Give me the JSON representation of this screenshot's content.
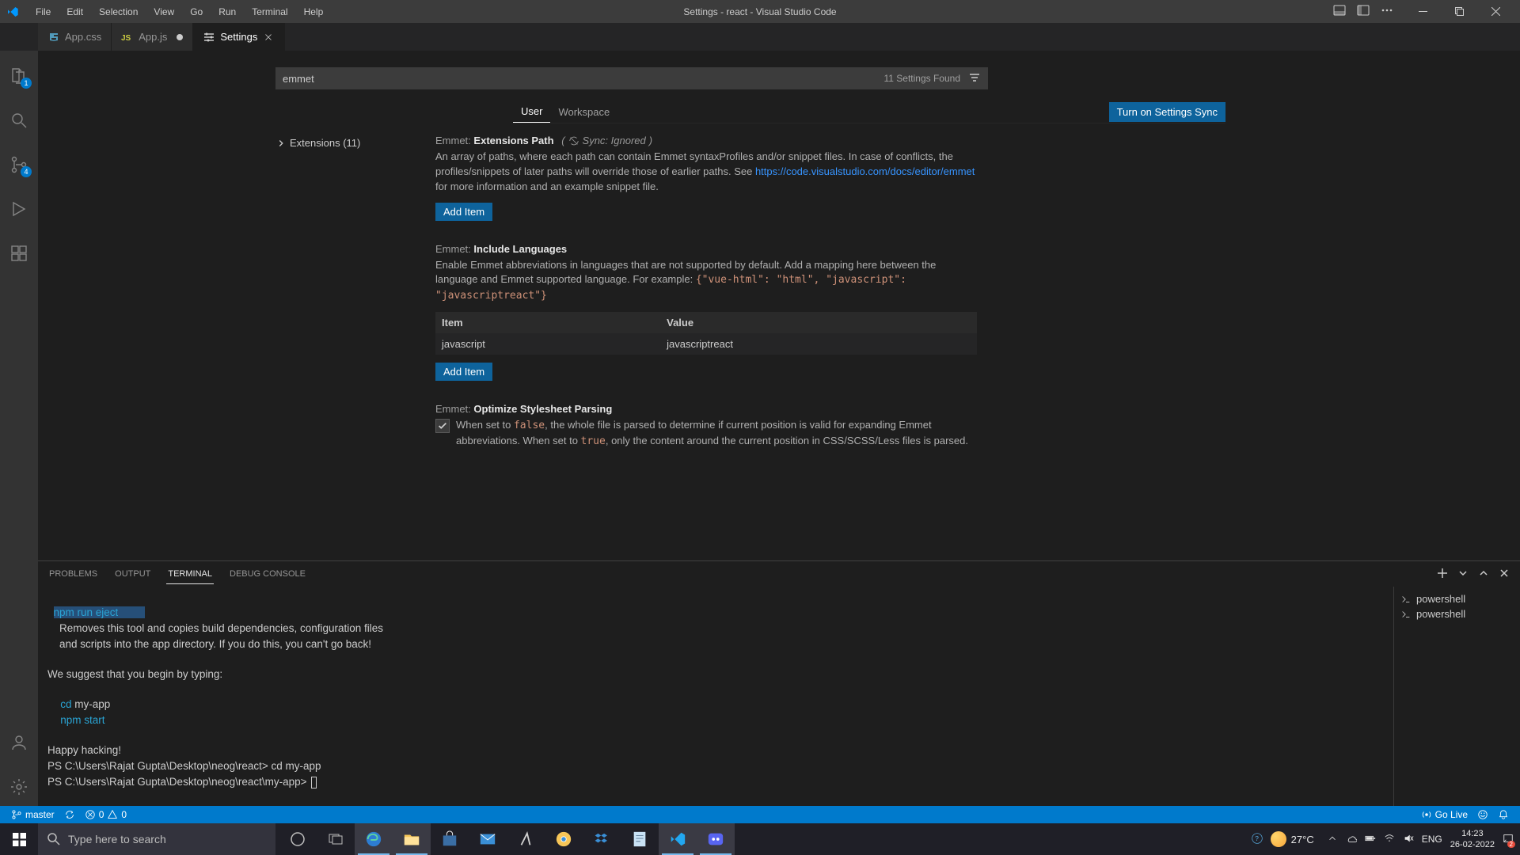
{
  "window": {
    "title": "Settings - react - Visual Studio Code"
  },
  "menu": [
    "File",
    "Edit",
    "Selection",
    "View",
    "Go",
    "Run",
    "Terminal",
    "Help"
  ],
  "tabs": [
    {
      "label": "App.css",
      "kind": "css",
      "active": false,
      "dirty": false
    },
    {
      "label": "App.js",
      "kind": "js",
      "active": false,
      "dirty": true
    },
    {
      "label": "Settings",
      "kind": "settings",
      "active": true,
      "dirty": false
    }
  ],
  "activity": {
    "explorer_badge": "1",
    "scm_badge": "4"
  },
  "settings": {
    "search_value": "emmet",
    "results_label": "11 Settings Found",
    "scope_tabs": [
      "User",
      "Workspace"
    ],
    "sync_button": "Turn on Settings Sync",
    "toc": {
      "extensions_label": "Extensions (11)"
    },
    "ext_path": {
      "prefix": "Emmet:",
      "name": "Extensions Path",
      "meta": "Sync: Ignored",
      "desc1": "An array of paths, where each path can contain Emmet syntaxProfiles and/or snippet files. In case of conflicts, the profiles/snippets of later paths will override those of earlier paths. See ",
      "link": "https://code.visualstudio.com/docs/editor/emmet",
      "desc2": " for more information and an example snippet file.",
      "add": "Add Item"
    },
    "include_lang": {
      "prefix": "Emmet:",
      "name": "Include Languages",
      "desc": "Enable Emmet abbreviations in languages that are not supported by default. Add a mapping here between the language and Emmet supported language. For example: ",
      "example": "{\"vue-html\": \"html\", \"javascript\": \"javascriptreact\"}",
      "col_item": "Item",
      "col_value": "Value",
      "rows": [
        {
          "item": "javascript",
          "value": "javascriptreact"
        }
      ],
      "add": "Add Item"
    },
    "optimize": {
      "prefix": "Emmet:",
      "name": "Optimize Stylesheet Parsing",
      "desc_a": "When set to ",
      "false_code": "false",
      "desc_b": ", the whole file is parsed to determine if current position is valid for expanding Emmet abbreviations. When set to ",
      "true_code": "true",
      "desc_c": ", only the content around the current position in CSS/SCSS/Less files is parsed."
    }
  },
  "panel": {
    "tabs": [
      "PROBLEMS",
      "OUTPUT",
      "TERMINAL",
      "DEBUG CONSOLE"
    ],
    "active_tab": "TERMINAL",
    "term_eject": "npm run eject",
    "term_eject_desc1": "    Removes this tool and copies build dependencies, configuration files",
    "term_eject_desc2": "    and scripts into the app directory. If you do this, you can't go back!",
    "term_suggest": "We suggest that you begin by typing:",
    "term_cd": "cd",
    "term_cd_arg": " my-app",
    "term_start": "npm start",
    "term_happy": "Happy hacking!",
    "term_ps1_path": "PS C:\\Users\\Rajat Gupta\\Desktop\\neog\\react> ",
    "term_ps1_cmd": "cd my-app",
    "term_ps2_path": "PS C:\\Users\\Rajat Gupta\\Desktop\\neog\\react\\my-app> ",
    "shells": [
      "powershell",
      "powershell"
    ]
  },
  "statusbar": {
    "branch": "master",
    "errors": "0",
    "warnings": "0",
    "golive": "Go Live"
  },
  "taskbar": {
    "search_placeholder": "Type here to search",
    "weather": "27°C",
    "lang": "ENG",
    "time": "14:23",
    "date": "26-02-2022",
    "notif_count": "2"
  }
}
